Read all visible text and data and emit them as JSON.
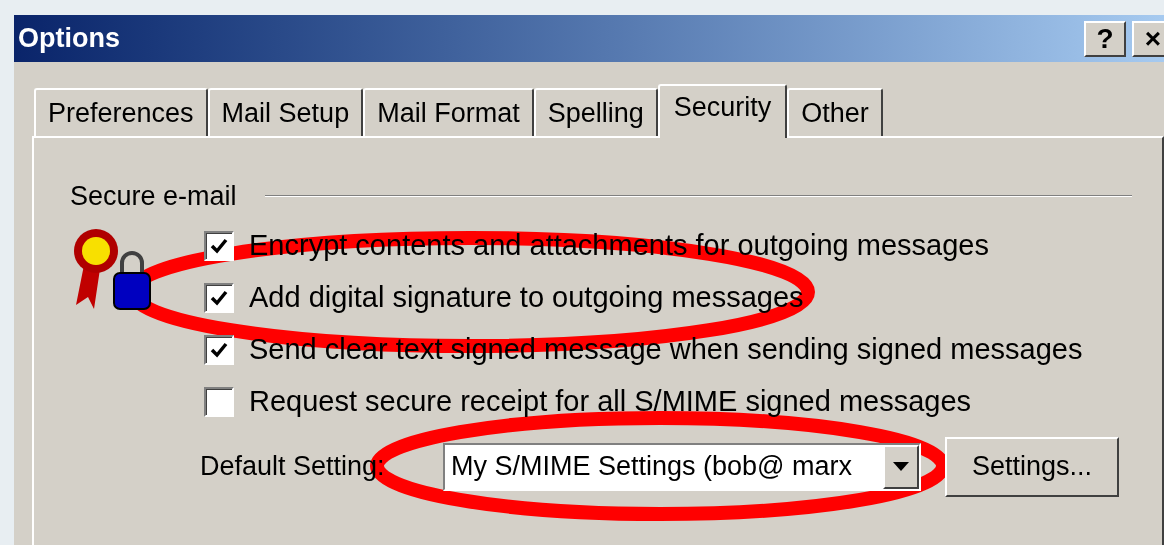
{
  "window": {
    "title": "Options",
    "buttons": [
      "?",
      "×"
    ]
  },
  "tabs": [
    {
      "label": "Preferences",
      "selected": false
    },
    {
      "label": "Mail Setup",
      "selected": false
    },
    {
      "label": "Mail Format",
      "selected": false
    },
    {
      "label": "Spelling",
      "selected": false
    },
    {
      "label": "Security",
      "selected": true
    },
    {
      "label": "Other",
      "selected": false
    }
  ],
  "secure_email": {
    "heading": "Secure e-mail",
    "options": [
      {
        "label": "Encrypt contents and attachments for outgoing messages",
        "checked": true
      },
      {
        "label": "Add digital signature to outgoing messages",
        "checked": true
      },
      {
        "label": "Send clear text signed message when sending signed messages",
        "checked": true
      },
      {
        "label": "Request secure receipt for all S/MIME signed messages",
        "checked": false
      }
    ],
    "default_setting": {
      "label": "Default Setting:",
      "value": "My S/MIME Settings (bob@ marx",
      "button": "Settings..."
    }
  },
  "annotations": [
    {
      "kind": "ellipse",
      "color": "#ff0000"
    },
    {
      "kind": "ellipse",
      "color": "#ff0000"
    }
  ]
}
